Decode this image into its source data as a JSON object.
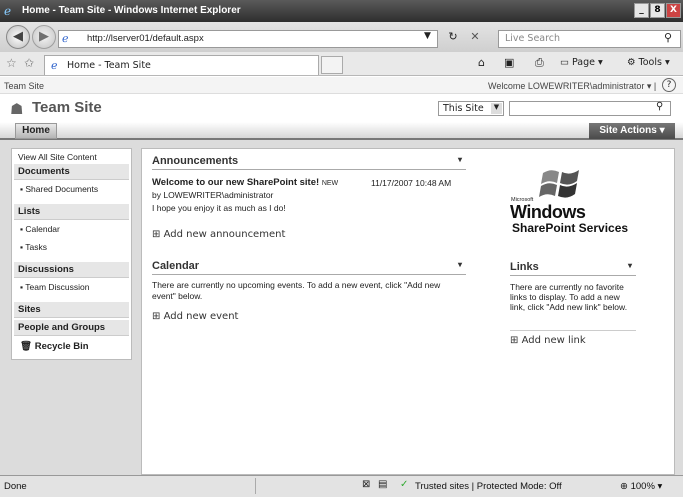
{
  "window": {
    "title": "Home - Team Site - Windows Internet Explorer",
    "min": "_",
    "max": "8",
    "close": "X"
  },
  "browser": {
    "address": "http://lserver01/default.aspx",
    "search_placeholder": "Live Search",
    "tab_title": "Home - Team Site",
    "cmd_page": "Page",
    "cmd_tools": "Tools"
  },
  "site": {
    "breadcrumb": "Team Site",
    "welcome": "Welcome LOWEWRITER\\administrator",
    "title": "Team Site",
    "scope": "This Site",
    "home_tab": "Home",
    "site_actions": "Site Actions"
  },
  "leftnav": {
    "view_all": "View All Site Content",
    "documents": "Documents",
    "shared_documents": "Shared Documents",
    "lists": "Lists",
    "calendar": "Calendar",
    "tasks": "Tasks",
    "discussions": "Discussions",
    "team_discussion": "Team Discussion",
    "sites": "Sites",
    "people_groups": "People and Groups",
    "recycle_bin": "Recycle Bin"
  },
  "announcements": {
    "title": "Announcements",
    "item_title": "Welcome to our new SharePoint site!",
    "new_badge": "NEW",
    "item_date": "11/17/2007 10:48 AM",
    "item_by": "by LOWEWRITER\\administrator",
    "item_body": "I hope you enjoy it as much as I do!",
    "add_link": "Add new announcement"
  },
  "calendar": {
    "title": "Calendar",
    "empty": "There are currently no upcoming events. To add a new event, click \"Add new event\" below.",
    "add_link": "Add new event"
  },
  "logo": {
    "small": "Microsoft",
    "line1": "Windows",
    "line2": "SharePoint Services"
  },
  "links": {
    "title": "Links",
    "empty": "There are currently no favorite links to display. To add a new link, click \"Add new link\" below.",
    "add_link": "Add new link"
  },
  "status": {
    "left": "Done",
    "zone": "Trusted sites | Protected Mode: Off",
    "zoom": "100%"
  }
}
